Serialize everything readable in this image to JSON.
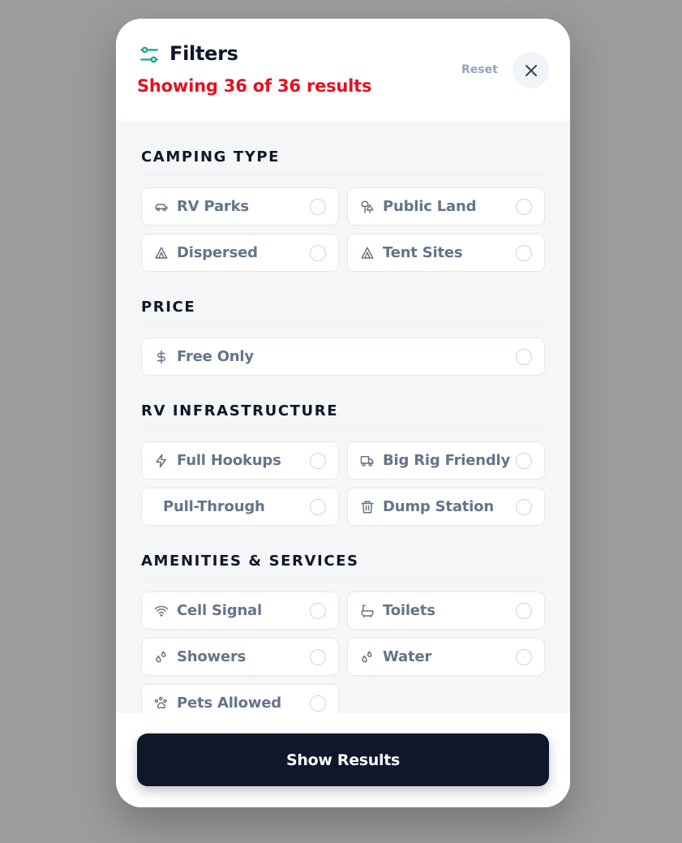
{
  "header": {
    "title": "Filters",
    "subtitle": "Showing 36 of 36 results",
    "reset_label": "Reset"
  },
  "sections": {
    "camping": {
      "title": "CAMPING TYPE",
      "options": [
        {
          "label": "RV Parks",
          "icon": "car-icon"
        },
        {
          "label": "Public Land",
          "icon": "trees-icon"
        },
        {
          "label": "Dispersed",
          "icon": "tent-icon"
        },
        {
          "label": "Tent Sites",
          "icon": "tent-icon"
        }
      ]
    },
    "price": {
      "title": "PRICE",
      "options": [
        {
          "label": "Free Only",
          "icon": "dollar-icon"
        }
      ]
    },
    "rv": {
      "title": "RV INFRASTRUCTURE",
      "options": [
        {
          "label": "Full Hookups",
          "icon": "lightning-icon"
        },
        {
          "label": "Big Rig Friendly",
          "icon": "truck-icon"
        },
        {
          "label": "Pull-Through",
          "icon": ""
        },
        {
          "label": "Dump Station",
          "icon": "trash-icon"
        }
      ]
    },
    "amenities": {
      "title": "AMENITIES & SERVICES",
      "options": [
        {
          "label": "Cell Signal",
          "icon": "wifi-icon"
        },
        {
          "label": "Toilets",
          "icon": "bath-icon"
        },
        {
          "label": "Showers",
          "icon": "droplets-icon"
        },
        {
          "label": "Water",
          "icon": "droplets-icon"
        },
        {
          "label": "Pets Allowed",
          "icon": "paw-icon"
        }
      ]
    }
  },
  "footer": {
    "show_results_label": "Show Results"
  },
  "colors": {
    "accent_icon": "#10a37f",
    "subtitle_red": "#e3111f",
    "primary_dark": "#0f172a",
    "option_text": "#64748b"
  }
}
